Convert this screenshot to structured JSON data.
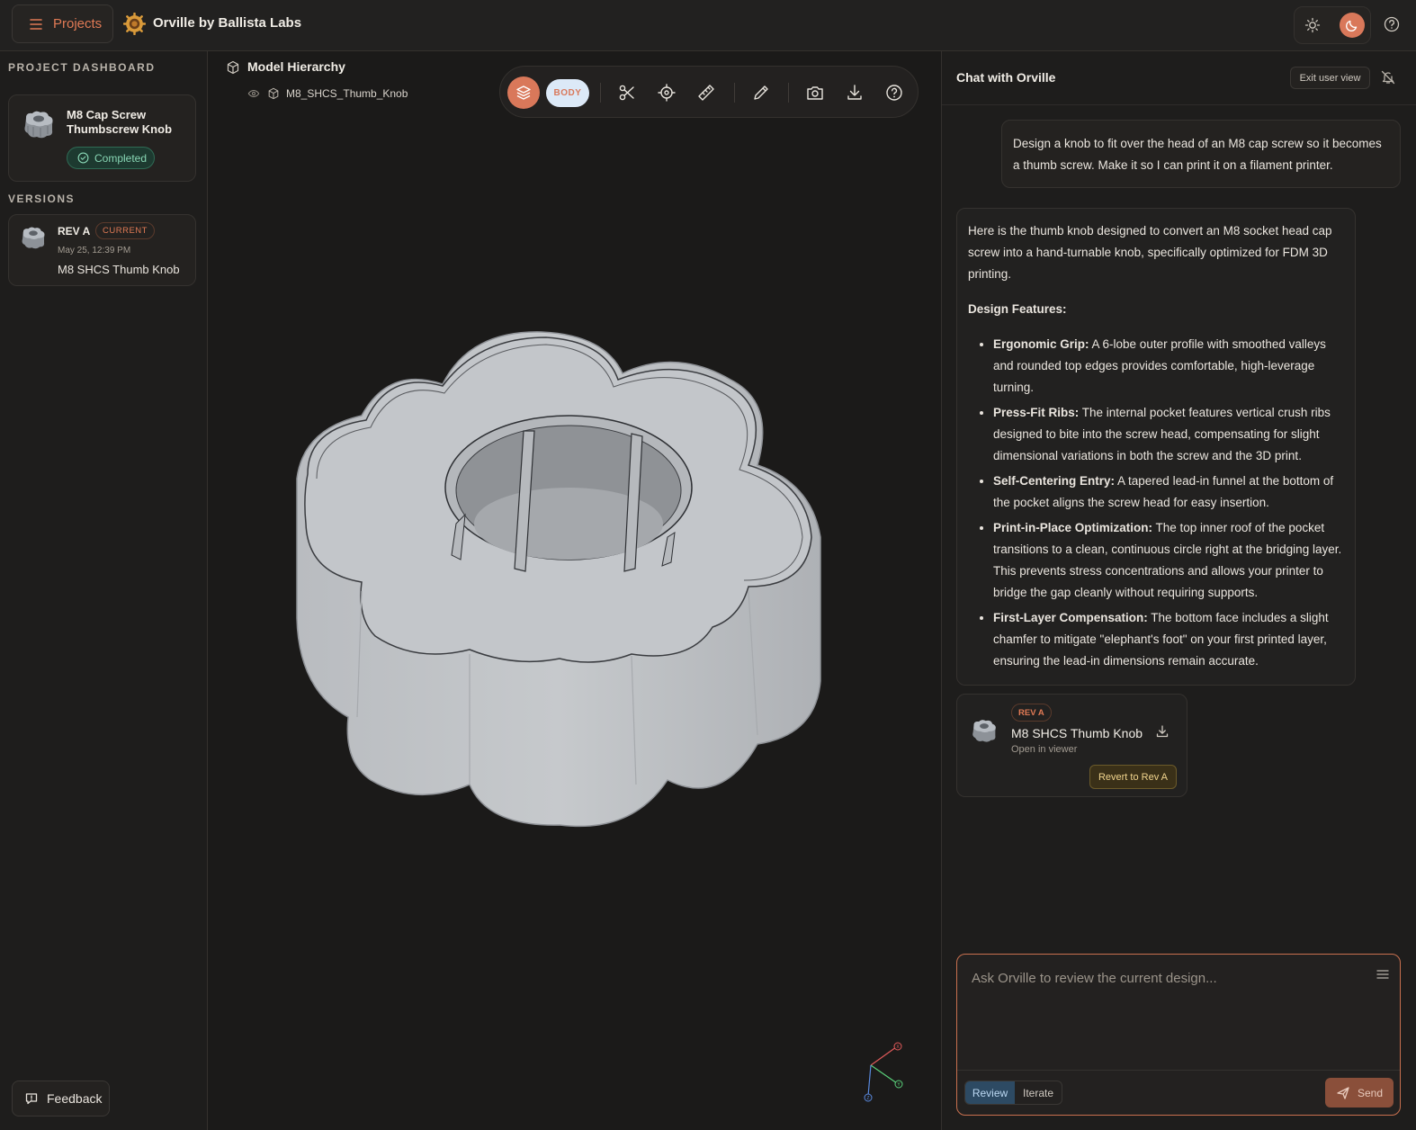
{
  "topbar": {
    "projects_label": "Projects",
    "app_title": "Orville by Ballista Labs"
  },
  "sidebar": {
    "dashboard_label": "PROJECT DASHBOARD",
    "project": {
      "title": "M8 Cap Screw Thumbscrew Knob",
      "status": "Completed"
    },
    "versions_label": "VERSIONS",
    "versions": [
      {
        "rev": "REV A",
        "badge": "CURRENT",
        "date": "May 25, 12:39 PM",
        "name": "M8 SHCS Thumb Knob"
      }
    ],
    "feedback_label": "Feedback"
  },
  "viewport": {
    "hierarchy_title": "Model Hierarchy",
    "hierarchy_item": "M8_SHCS_Thumb_Knob",
    "body_toggle": "BODY",
    "axes": [
      "X",
      "Y",
      "Z"
    ]
  },
  "chat": {
    "title": "Chat with Orville",
    "exit_label": "Exit user view",
    "user_message": "Design a knob to fit over the head of an M8 cap screw so it becomes a thumb screw. Make it so I can print it on a filament printer.",
    "bot_intro": "Here is the thumb knob designed to convert an M8 socket head cap screw into a hand-turnable knob, specifically optimized for FDM 3D printing.",
    "bot_heading": "Design Features:",
    "features": [
      {
        "title": "Ergonomic Grip:",
        "text": " A 6-lobe outer profile with smoothed valleys and rounded top edges provides comfortable, high-leverage turning."
      },
      {
        "title": "Press-Fit Ribs:",
        "text": " The internal pocket features vertical crush ribs designed to bite into the screw head, compensating for slight dimensional variations in both the screw and the 3D print."
      },
      {
        "title": "Self-Centering Entry:",
        "text": " A tapered lead-in funnel at the bottom of the pocket aligns the screw head for easy insertion."
      },
      {
        "title": "Print-in-Place Optimization:",
        "text": " The top inner roof of the pocket transitions to a clean, continuous circle right at the bridging layer. This prevents stress concentrations and allows your printer to bridge the gap cleanly without requiring supports."
      },
      {
        "title": "First-Layer Compensation:",
        "text": " The bottom face includes a slight chamfer to mitigate \"elephant's foot\" on your first printed layer, ensuring the lead-in dimensions remain accurate."
      }
    ],
    "rev_card": {
      "badge": "REV A",
      "name": "M8 SHCS Thumb Knob",
      "open_label": "Open in viewer",
      "revert_label": "Revert to Rev A"
    },
    "input_placeholder": "Ask Orville to review the current design...",
    "mode_review": "Review",
    "mode_iterate": "Iterate",
    "send_label": "Send"
  },
  "colors": {
    "accent": "#d9785a",
    "background": "#1b1a19",
    "panel": "#1e1d1c",
    "success": "#88d6b4"
  }
}
